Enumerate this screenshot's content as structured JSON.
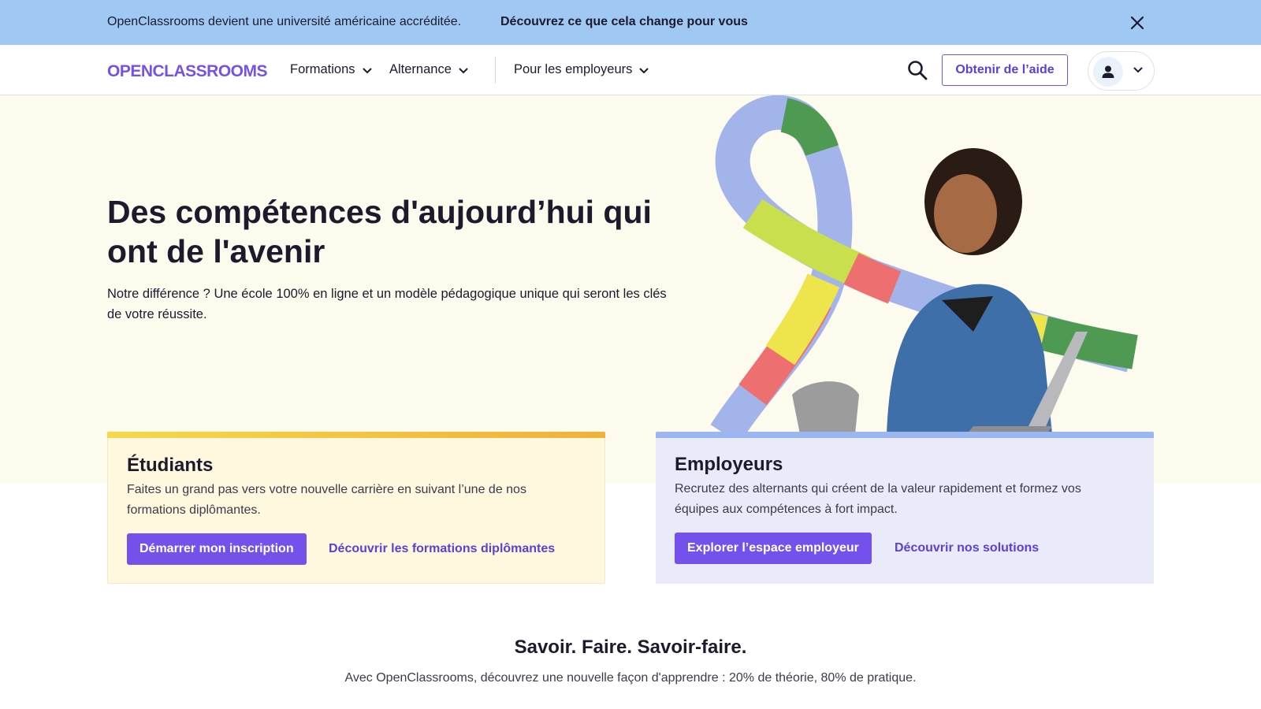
{
  "banner": {
    "text": "OpenClassrooms devient une université américaine accréditée.",
    "link": "Découvrez ce que cela change pour vous",
    "close_icon": "close-icon"
  },
  "header": {
    "logo": "OPENCLASSROOMS",
    "nav": [
      {
        "label": "Formations"
      },
      {
        "label": "Alternance"
      },
      {
        "label": "Pour les employeurs"
      }
    ],
    "search_icon": "search-icon",
    "help_label": "Obtenir de l’aide",
    "account_icon": "user-icon"
  },
  "hero": {
    "title": "Des compétences d'aujourd’hui qui ont de l'avenir",
    "subtitle": "Notre différence ? Une école 100% en ligne et un modèle pédagogique unique qui seront les clés de votre réussite."
  },
  "cards": {
    "students": {
      "title": "Étudiants",
      "text": "Faites un grand pas vers votre nouvelle carrière en suivant l’une de nos formations diplômantes.",
      "button": "Démarrer mon inscription",
      "link": "Découvrir les formations diplômantes"
    },
    "employers": {
      "title": "Employeurs",
      "text": "Recrutez des alternants qui créent de la valeur rapidement et formez vos équipes aux compétences à fort impact.",
      "button": "Explorer l’espace employeur",
      "link": "Découvrir nos solutions"
    }
  },
  "section": {
    "title": "Savoir. Faire. Savoir-faire.",
    "subtitle": "Avec OpenClassrooms, découvrez une nouvelle façon d'apprendre : 20% de théorie, 80% de pratique."
  },
  "colors": {
    "brand": "#7451eb",
    "banner": "#9fc8f3",
    "hero_bg": "#fdfaee",
    "students_card": "#fdf8de",
    "employers_card": "#e9ebfa"
  }
}
